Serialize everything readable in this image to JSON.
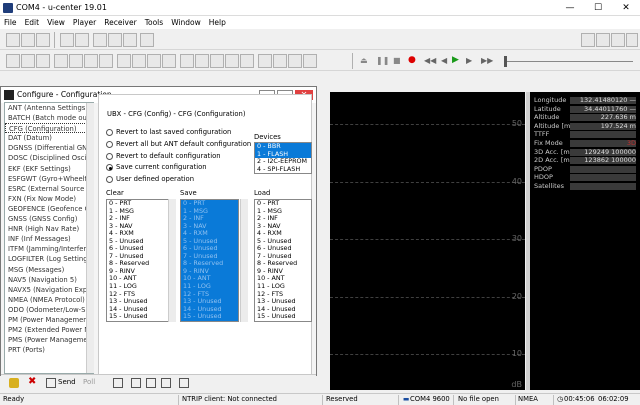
{
  "app": {
    "title": "COM4 - u-center 19.01"
  },
  "menu": [
    "File",
    "Edit",
    "View",
    "Player",
    "Receiver",
    "Tools",
    "Window",
    "Help"
  ],
  "dialog": {
    "title": "Configure - Configuration",
    "heading": "UBX - CFG (Config) - CFG (Configuration)",
    "left_list": [
      "ANT (Antenna Settings)",
      "BATCH (Batch mode outp",
      "CFG (Configuration)",
      "DAT (Datum)",
      "DGNSS (Differential GNSS",
      "DOSC (Disciplined Oscilla",
      "EKF (EKF Settings)",
      "ESFGWT (Gyro+Wheeltick",
      "ESRC (External Source Co",
      "FXN (Fix Now Mode)",
      "GEOFENCE (Geofence Co",
      "GNSS (GNSS Config)",
      "HNR (High Nav Rate)",
      "INF (Inf Messages)",
      "ITFM (Jamming/Interferen",
      "LOGFILTER (Log Settings",
      "MSG (Messages)",
      "NAV5 (Navigation 5)",
      "NAVX5 (Navigation Expe",
      "NMEA (NMEA Protocol)",
      "ODO (Odometer/Low-Sp",
      "PM (Power Management",
      "PM2 (Extended Power M",
      "PMS (Power Managemer",
      "PRT (Ports)"
    ],
    "options": [
      "Revert to last saved configuration",
      "Revert all but ANT default configuration",
      "Revert to default configuration",
      "Save current configuration",
      "User defined operation"
    ],
    "selected_option": 3,
    "devices_label": "Devices",
    "devices": [
      "0 - BBR",
      "1 - FLASH",
      "2 - I2C-EEPROM",
      "4 - SPI-FLASH"
    ],
    "clear_label": "Clear",
    "save_label": "Save",
    "load_label": "Load",
    "sections": [
      "0 - PRT",
      "1 - MSG",
      "2 - INF",
      "3 - NAV",
      "4 - RXM",
      "5 - Unused",
      "6 - Unused",
      "7 - Unused",
      "8 - Reserved",
      "9 - RINV",
      "10 - ANT",
      "11 - LOG",
      "12 - FTS",
      "13 - Unused",
      "14 - Unused",
      "15 - Unused"
    ],
    "send_label": "Send",
    "poll_label": "Poll"
  },
  "graph": {
    "ticks": [
      "50",
      "40",
      "30",
      "20",
      "10"
    ],
    "unit": "dB"
  },
  "info": {
    "rows": [
      {
        "k": "Longitude",
        "v": "132.41480120 —"
      },
      {
        "k": "Latitude",
        "v": "34.44011760 —"
      },
      {
        "k": "Altitude",
        "v": "227.636 m"
      },
      {
        "k": "Altitude [msl]",
        "v": "197.524 m"
      },
      {
        "k": "TTFF",
        "v": ""
      },
      {
        "k": "Fix Mode",
        "v": "3D"
      },
      {
        "k": "3D Acc. [m]",
        "v": "129249 100000"
      },
      {
        "k": "2D Acc. [m]",
        "v": "123862 100000"
      },
      {
        "k": "PDOP",
        "v": ""
      },
      {
        "k": "HDOP",
        "v": ""
      },
      {
        "k": "Satellites",
        "v": ""
      }
    ],
    "fix_color": "#c03030"
  },
  "status": {
    "ready": "Ready",
    "ntrip": "NTRIP client: Not connected",
    "reserved": "Reserved",
    "port": "COM4 9600",
    "file": "No file open",
    "protocol": "NMEA",
    "time1": "00:45:06",
    "time2": "06:02:09"
  }
}
